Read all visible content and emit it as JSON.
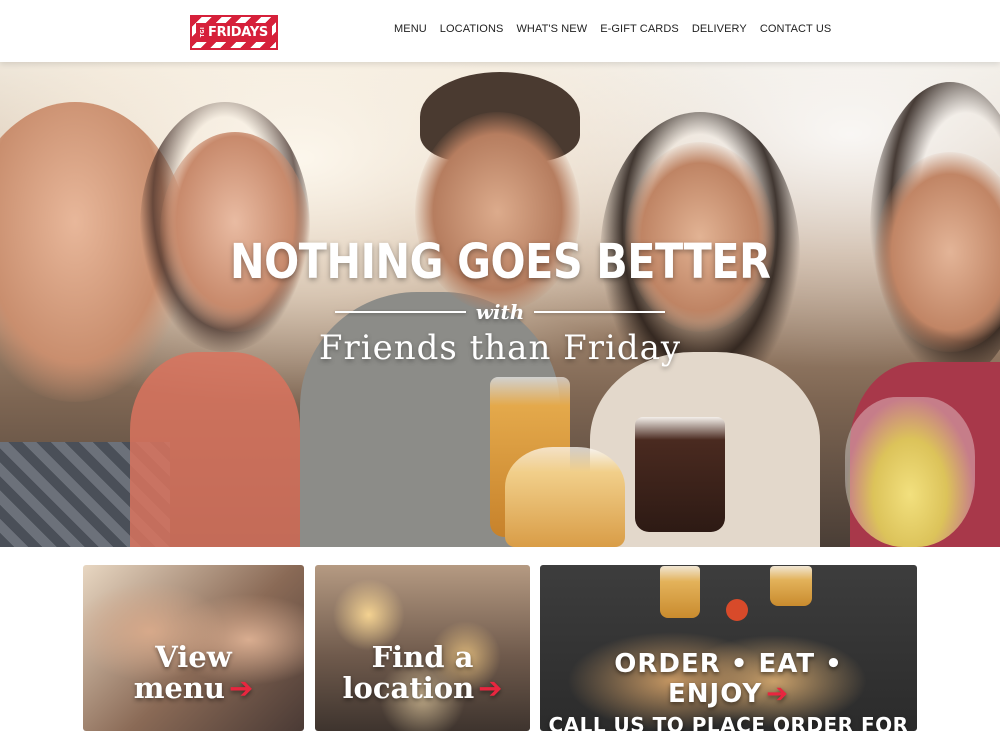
{
  "header": {
    "logo": {
      "small_text": "TGI",
      "brand_text": "FRIDAYS"
    },
    "nav": [
      {
        "label": "MENU"
      },
      {
        "label": "LOCATIONS"
      },
      {
        "label": "WHAT'S NEW"
      },
      {
        "label": "E-GIFT CARDS"
      },
      {
        "label": "DELIVERY"
      },
      {
        "label": "CONTACT US"
      }
    ]
  },
  "hero": {
    "line1": "NOTHING GOES BETTER",
    "line2": "with",
    "line3": "Friends than Friday"
  },
  "tiles": {
    "menu": {
      "line1": "View",
      "line2": "menu",
      "arrow": "➔"
    },
    "location": {
      "line1": "Find a",
      "line2": "location",
      "arrow": "➔"
    },
    "order": {
      "line1": "ORDER • EAT •",
      "line2": "ENJOY",
      "arrow": "➔",
      "subtext": "CALL US TO PLACE ORDER FOR"
    }
  },
  "colors": {
    "brand_red": "#d6203a",
    "arrow_red": "#e8263f",
    "nav_text": "#222222"
  },
  "icons": {
    "arrow": "arrow-right-icon"
  }
}
